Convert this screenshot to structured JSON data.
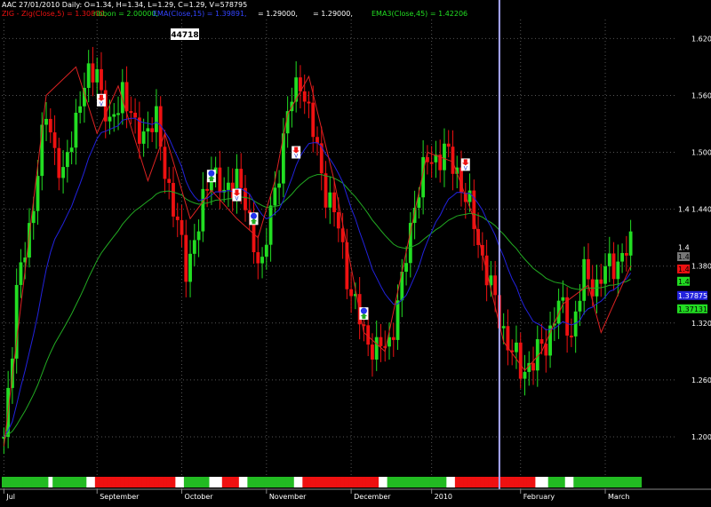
{
  "header": {
    "info": "AAC 27/01/2010 Daily: O=1.34, H=1.34, L=1.29, C=1.29, V=578795",
    "zig": "ZIG - Zig(Close,5) = 1.30800,",
    "ribbon": "ribbon = 2.00000,",
    "ema_blue": "EMA(Close,15) = 1.39891,",
    "val_a": "= 1.29000,",
    "val_b": "= 1.29000,",
    "ema3": "EMA3(Close,45) = 1.42206"
  },
  "callout": "44718",
  "colors": {
    "up": "#22dd22",
    "down": "#ee1111",
    "ema_fast": "#2222dd",
    "ema_slow": "#22aa22",
    "zig": "#dd2222",
    "cursor": "#aaaaff",
    "grid": "#555555"
  },
  "chart_data": {
    "type": "candlestick",
    "ylim": [
      1.17,
      1.64
    ],
    "y_ticks": [
      "1.620",
      "1.560",
      "1.500",
      "1.440",
      "1.380",
      "1.320",
      "1.260",
      "1.200"
    ],
    "x_labels": [
      "Jul",
      "September",
      "October",
      "November",
      "December",
      "2010",
      "February",
      "March"
    ],
    "x_label_idx": [
      0,
      22,
      42,
      62,
      82,
      101,
      122,
      142
    ],
    "cursor_idx": 117,
    "n_bars": 149,
    "right_badges": [
      {
        "text": "1.4",
        "value": 1.44,
        "bg": "#000000",
        "fg": "#ffffff"
      },
      {
        "text": "1.4",
        "value": 1.4,
        "bg": "#000000",
        "fg": "#ffffff"
      },
      {
        "text": "1.4",
        "value": 1.39,
        "bg": "#777777",
        "fg": "#000000"
      },
      {
        "text": "1.4",
        "value": 1.377,
        "bg": "#ee1111",
        "fg": "#000000"
      },
      {
        "text": "1.4",
        "value": 1.364,
        "bg": "#22dd22",
        "fg": "#000000"
      },
      {
        "text": "1.37875",
        "value": 1.349,
        "bg": "#2222dd",
        "fg": "#ffffff"
      },
      {
        "text": "1.37131",
        "value": 1.335,
        "bg": "#22dd22",
        "fg": "#000000"
      }
    ],
    "close_anchors": [
      [
        0,
        1.2
      ],
      [
        3,
        1.35
      ],
      [
        6,
        1.42
      ],
      [
        10,
        1.54
      ],
      [
        14,
        1.47
      ],
      [
        18,
        1.56
      ],
      [
        22,
        1.59
      ],
      [
        25,
        1.52
      ],
      [
        28,
        1.57
      ],
      [
        31,
        1.52
      ],
      [
        36,
        1.53
      ],
      [
        40,
        1.44
      ],
      [
        43,
        1.38
      ],
      [
        46,
        1.42
      ],
      [
        49,
        1.49
      ],
      [
        52,
        1.45
      ],
      [
        55,
        1.48
      ],
      [
        58,
        1.42
      ],
      [
        61,
        1.38
      ],
      [
        64,
        1.46
      ],
      [
        67,
        1.54
      ],
      [
        70,
        1.58
      ],
      [
        73,
        1.52
      ],
      [
        76,
        1.46
      ],
      [
        79,
        1.42
      ],
      [
        82,
        1.35
      ],
      [
        85,
        1.31
      ],
      [
        88,
        1.29
      ],
      [
        91,
        1.3
      ],
      [
        94,
        1.36
      ],
      [
        97,
        1.45
      ],
      [
        100,
        1.49
      ],
      [
        104,
        1.5
      ],
      [
        107,
        1.48
      ],
      [
        110,
        1.44
      ],
      [
        113,
        1.39
      ],
      [
        116,
        1.34
      ],
      [
        119,
        1.3
      ],
      [
        122,
        1.27
      ],
      [
        125,
        1.28
      ],
      [
        128,
        1.3
      ],
      [
        131,
        1.34
      ],
      [
        134,
        1.31
      ],
      [
        137,
        1.37
      ],
      [
        140,
        1.36
      ],
      [
        143,
        1.38
      ],
      [
        146,
        1.39
      ],
      [
        148,
        1.4
      ]
    ],
    "zig_points": [
      [
        0,
        1.19
      ],
      [
        10,
        1.56
      ],
      [
        17,
        1.59
      ],
      [
        22,
        1.52
      ],
      [
        27,
        1.57
      ],
      [
        34,
        1.47
      ],
      [
        38,
        1.52
      ],
      [
        44,
        1.43
      ],
      [
        49,
        1.46
      ],
      [
        55,
        1.43
      ],
      [
        60,
        1.41
      ],
      [
        64,
        1.47
      ],
      [
        67,
        1.54
      ],
      [
        72,
        1.58
      ],
      [
        78,
        1.47
      ],
      [
        85,
        1.31
      ],
      [
        90,
        1.29
      ],
      [
        100,
        1.5
      ],
      [
        106,
        1.49
      ],
      [
        111,
        1.43
      ],
      [
        118,
        1.3
      ],
      [
        123,
        1.27
      ],
      [
        127,
        1.29
      ],
      [
        132,
        1.34
      ],
      [
        138,
        1.36
      ],
      [
        141,
        1.31
      ],
      [
        148,
        1.38
      ]
    ],
    "signals": [
      {
        "idx": 23,
        "value": 1.555,
        "kind": "sell"
      },
      {
        "idx": 55,
        "value": 1.455,
        "kind": "sell"
      },
      {
        "idx": 69,
        "value": 1.5,
        "kind": "sell"
      },
      {
        "idx": 49,
        "value": 1.475,
        "kind": "buy"
      },
      {
        "idx": 59,
        "value": 1.43,
        "kind": "buy"
      },
      {
        "idx": 85,
        "value": 1.33,
        "kind": "buy"
      },
      {
        "idx": 109,
        "value": 1.487,
        "kind": "sell"
      }
    ],
    "ribbon": [
      "g",
      "g",
      "g",
      "g",
      "g",
      "g",
      "g",
      "g",
      "g",
      "g",
      "g",
      "w",
      "g",
      "g",
      "g",
      "g",
      "g",
      "g",
      "g",
      "g",
      "w",
      "w",
      "r",
      "r",
      "r",
      "r",
      "r",
      "r",
      "r",
      "r",
      "r",
      "r",
      "r",
      "r",
      "r",
      "r",
      "r",
      "r",
      "r",
      "r",
      "r",
      "w",
      "w",
      "g",
      "g",
      "g",
      "g",
      "g",
      "g",
      "w",
      "w",
      "w",
      "r",
      "r",
      "r",
      "r",
      "w",
      "w",
      "g",
      "g",
      "g",
      "g",
      "g",
      "g",
      "g",
      "g",
      "g",
      "g",
      "g",
      "w",
      "w",
      "r",
      "r",
      "r",
      "r",
      "r",
      "r",
      "r",
      "r",
      "r",
      "r",
      "r",
      "r",
      "r",
      "r",
      "r",
      "r",
      "r",
      "r",
      "w",
      "w",
      "g",
      "g",
      "g",
      "g",
      "g",
      "g",
      "g",
      "g",
      "g",
      "g",
      "g",
      "g",
      "g",
      "g",
      "w",
      "w",
      "r",
      "r",
      "r",
      "r",
      "r",
      "r",
      "r",
      "r",
      "r",
      "r",
      "r",
      "r",
      "r",
      "r",
      "r",
      "r",
      "r",
      "r",
      "r",
      "w",
      "w",
      "w",
      "g",
      "g",
      "g",
      "g",
      "w",
      "w",
      "g",
      "g",
      "g",
      "g",
      "g",
      "g",
      "g",
      "g",
      "g",
      "g",
      "g",
      "g",
      "g",
      "g",
      "g",
      "g"
    ]
  }
}
